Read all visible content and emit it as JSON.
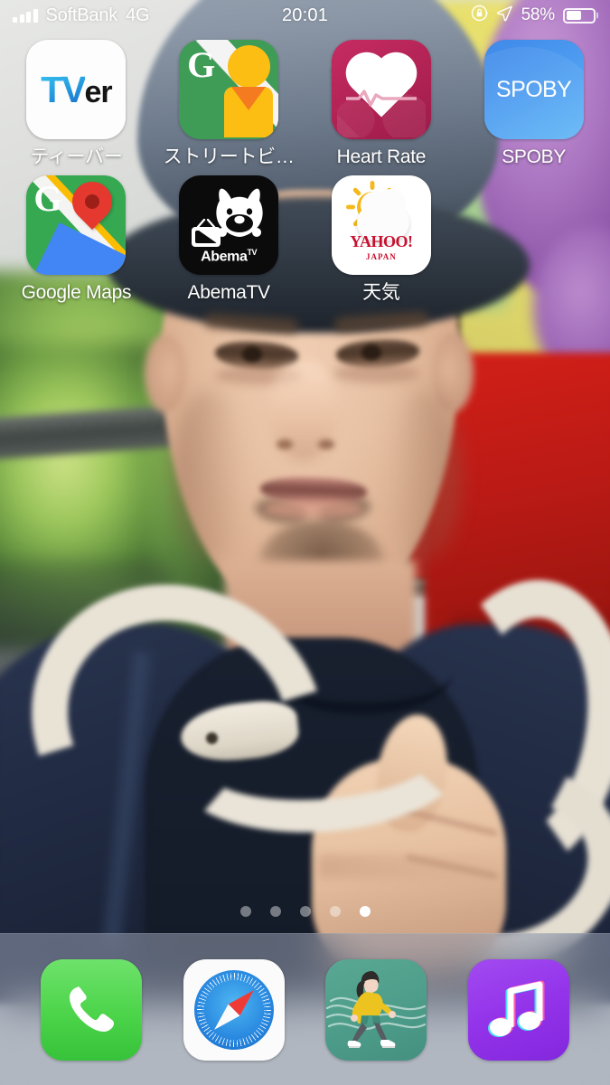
{
  "statusbar": {
    "signal_icon": "cellular-signal-bars-icon",
    "carrier": "SoftBank",
    "network": "4G",
    "time": "20:01",
    "rotation_lock_icon": "rotation-lock-icon",
    "location_icon": "location-arrow-icon",
    "battery_percent": "58%",
    "battery_level": 58,
    "battery_icon": "battery-icon"
  },
  "homescreen": {
    "rows": [
      [
        {
          "name": "tver",
          "label": "ティーバー",
          "icon": "tver-icon",
          "logo_tv": "TV",
          "logo_er": "er"
        },
        {
          "name": "street-view",
          "label": "ストリートビ…",
          "icon": "street-view-icon",
          "logo_letter": "G"
        },
        {
          "name": "heart-rate",
          "label": "Heart Rate",
          "icon": "heart-rate-icon"
        },
        {
          "name": "spoby",
          "label": "SPOBY",
          "icon": "spoby-icon",
          "logo_text": "SPOBY"
        }
      ],
      [
        {
          "name": "google-maps",
          "label": "Google Maps",
          "icon": "google-maps-icon",
          "logo_letter": "G"
        },
        {
          "name": "abematv",
          "label": "AbemaTV",
          "icon": "abematv-icon",
          "logo_text": "Abema",
          "logo_sup": "TV"
        },
        {
          "name": "yahoo-weather",
          "label": "天気",
          "icon": "yahoo-weather-icon",
          "logo_text": "YAHOO!",
          "logo_sub": "JAPAN"
        },
        {
          "name": "empty-slot",
          "label": "",
          "icon": ""
        }
      ]
    ]
  },
  "pagedots": {
    "count": 5,
    "active_index": 4
  },
  "dock": {
    "apps": [
      {
        "name": "phone",
        "icon": "phone-handset-icon",
        "label": ""
      },
      {
        "name": "safari",
        "icon": "safari-compass-icon",
        "label": ""
      },
      {
        "name": "walking-tracker",
        "icon": "walking-person-icon",
        "label": ""
      },
      {
        "name": "music",
        "icon": "music-note-icon",
        "label": ""
      }
    ]
  },
  "wallpaper": {
    "description": "photo-of-man-with-white-snake",
    "accent_colors": {
      "cap": "#4c5766",
      "sweater": "#18202f",
      "snake": "#e9e3d6",
      "curtain_red": "#bb1a15",
      "balloon_purple": "#9a63b4",
      "foliage_green": "#8cba52"
    }
  }
}
